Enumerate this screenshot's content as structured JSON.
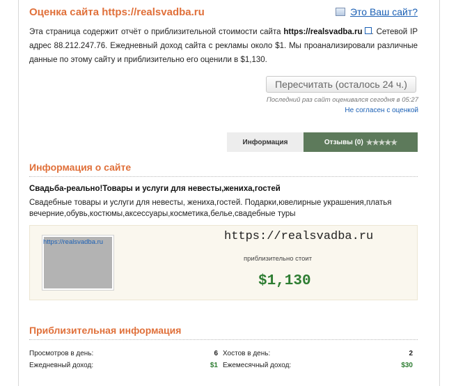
{
  "header": {
    "title": "Оценка сайта https://realsvadba.ru",
    "owner_link": "Это Ваш сайт?"
  },
  "intro": {
    "part1": "Эта страница содержит отчёт о приблизительной стоимости сайта ",
    "site": "https://realsvadba.ru",
    "part2": ". Сетевой IP адрес 88.212.247.76. Ежедневный доход сайта с рекламы около $1. Мы проанализировали различные данные по этому сайту и приблизительно его оценили в $1,130."
  },
  "actions": {
    "recalc_label": "Пересчитать (осталось 24 ч.)",
    "last_check": "Последний раз сайт оценивался сегодня в 05:27",
    "disagree": "Не согласен с оценкой"
  },
  "tabs": {
    "info": "Информация",
    "reviews": "Отзывы (0)",
    "stars": "★★★★★"
  },
  "site_info": {
    "heading": "Информация о сайте",
    "name": "Свадьба-реально!Товары и услуги для невесты,жениха,гостей",
    "description": "Свадебные товары и услуги для невесты, жениха,гостей. Подарки,ювелирные украшения,платья вечерние,обувь,костюмы,аксессуары,косметика,белье,свадебные туры",
    "thumb_url": "https://realsvadba.ru",
    "url": "https://realsvadba.ru",
    "approx_label": "приблизительно стоит",
    "price": "$1,130"
  },
  "approx_info": {
    "heading": "Приблизительная информация",
    "views_label": "Просмотров в день:",
    "views_value": "6",
    "hosts_label": "Хостов в день:",
    "hosts_value": "2",
    "daily_label": "Ежедневный доход:",
    "daily_value": "$1",
    "monthly_label": "Ежемесячный доход:",
    "monthly_value": "$30"
  },
  "colors": {
    "accent": "#e0703a",
    "link": "#1a5fb4",
    "money": "#2e7d32",
    "tab_active": "#5d7a5b"
  }
}
